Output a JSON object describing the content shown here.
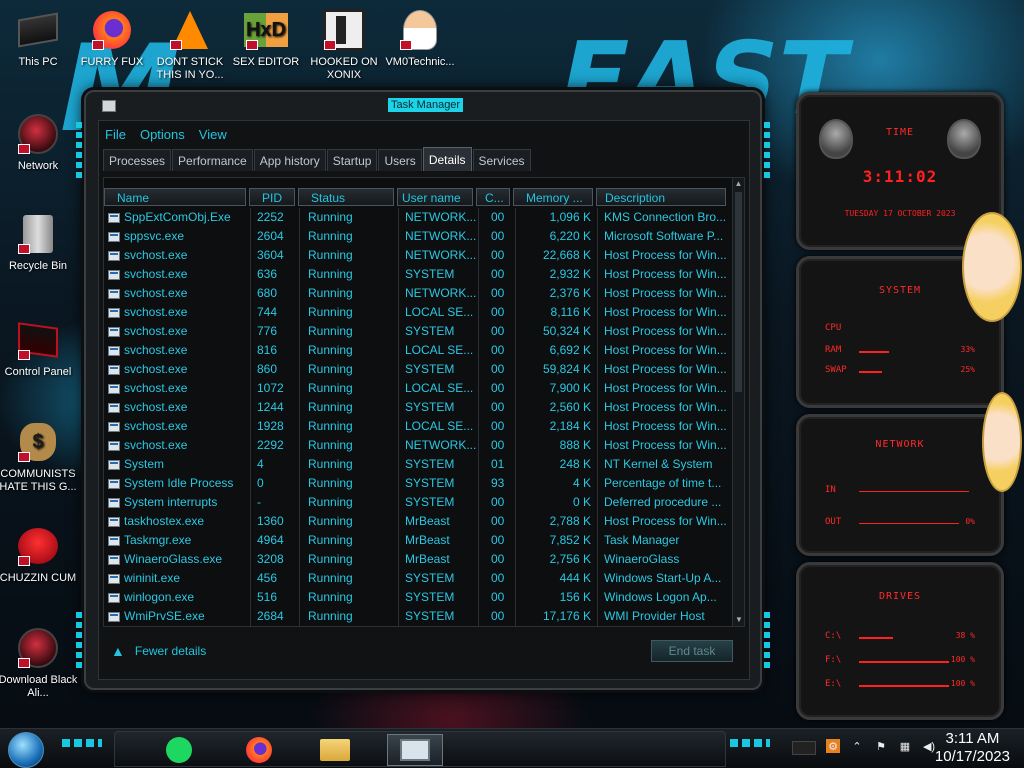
{
  "desktop": {
    "icons": [
      {
        "label": "This PC",
        "icon": "computer-icon"
      },
      {
        "label": "FURRY FUX",
        "icon": "firefox-icon"
      },
      {
        "label": "DONT STICK THIS IN YO...",
        "icon": "vlc-icon"
      },
      {
        "label": "SEX EDITOR",
        "icon": "hxd-icon"
      },
      {
        "label": "HOOKED ON XONIX",
        "icon": "xonix-icon"
      },
      {
        "label": "VM0Technic...",
        "icon": "doctor-icon"
      },
      {
        "label": "Network",
        "icon": "alien-icon"
      },
      {
        "label": "Recycle Bin",
        "icon": "recycle-bin-icon"
      },
      {
        "label": "Control Panel",
        "icon": "control-panel-icon"
      },
      {
        "label": "COMMUNISTS HATE THIS G...",
        "icon": "money-bag-icon"
      },
      {
        "label": "CHUZZIN CUM",
        "icon": "chuzzle-icon"
      },
      {
        "label": "Download Black Ali...",
        "icon": "alien-icon"
      }
    ]
  },
  "taskmgr": {
    "title": "Task Manager",
    "menu": [
      "File",
      "Options",
      "View"
    ],
    "tabs": [
      "Processes",
      "Performance",
      "App history",
      "Startup",
      "Users",
      "Details",
      "Services"
    ],
    "active_tab": "Details",
    "columns": [
      "Name",
      "PID",
      "Status",
      "User name",
      "C...",
      "Memory ...",
      "Description"
    ],
    "rows": [
      [
        "SppExtComObj.Exe",
        "2252",
        "Running",
        "NETWORK...",
        "00",
        "1,096 K",
        "KMS Connection Bro..."
      ],
      [
        "sppsvc.exe",
        "2604",
        "Running",
        "NETWORK...",
        "00",
        "6,220 K",
        "Microsoft Software P..."
      ],
      [
        "svchost.exe",
        "3604",
        "Running",
        "NETWORK...",
        "00",
        "22,668 K",
        "Host Process for Win..."
      ],
      [
        "svchost.exe",
        "636",
        "Running",
        "SYSTEM",
        "00",
        "2,932 K",
        "Host Process for Win..."
      ],
      [
        "svchost.exe",
        "680",
        "Running",
        "NETWORK...",
        "00",
        "2,376 K",
        "Host Process for Win..."
      ],
      [
        "svchost.exe",
        "744",
        "Running",
        "LOCAL SE...",
        "00",
        "8,116 K",
        "Host Process for Win..."
      ],
      [
        "svchost.exe",
        "776",
        "Running",
        "SYSTEM",
        "00",
        "50,324 K",
        "Host Process for Win..."
      ],
      [
        "svchost.exe",
        "816",
        "Running",
        "LOCAL SE...",
        "00",
        "6,692 K",
        "Host Process for Win..."
      ],
      [
        "svchost.exe",
        "860",
        "Running",
        "SYSTEM",
        "00",
        "59,824 K",
        "Host Process for Win..."
      ],
      [
        "svchost.exe",
        "1072",
        "Running",
        "LOCAL SE...",
        "00",
        "7,900 K",
        "Host Process for Win..."
      ],
      [
        "svchost.exe",
        "1244",
        "Running",
        "SYSTEM",
        "00",
        "2,560 K",
        "Host Process for Win..."
      ],
      [
        "svchost.exe",
        "1928",
        "Running",
        "LOCAL SE...",
        "00",
        "2,184 K",
        "Host Process for Win..."
      ],
      [
        "svchost.exe",
        "2292",
        "Running",
        "NETWORK...",
        "00",
        "888 K",
        "Host Process for Win..."
      ],
      [
        "System",
        "4",
        "Running",
        "SYSTEM",
        "01",
        "248 K",
        "NT Kernel & System"
      ],
      [
        "System Idle Process",
        "0",
        "Running",
        "SYSTEM",
        "93",
        "4 K",
        "Percentage of time t..."
      ],
      [
        "System interrupts",
        "-",
        "Running",
        "SYSTEM",
        "00",
        "0 K",
        "Deferred procedure ..."
      ],
      [
        "taskhostex.exe",
        "1360",
        "Running",
        "MrBeast",
        "00",
        "2,788 K",
        "Host Process for Win..."
      ],
      [
        "Taskmgr.exe",
        "4964",
        "Running",
        "MrBeast",
        "00",
        "7,852 K",
        "Task Manager"
      ],
      [
        "WinaeroGlass.exe",
        "3208",
        "Running",
        "MrBeast",
        "00",
        "2,756 K",
        "WinaeroGlass"
      ],
      [
        "wininit.exe",
        "456",
        "Running",
        "SYSTEM",
        "00",
        "444 K",
        "Windows Start-Up A..."
      ],
      [
        "winlogon.exe",
        "516",
        "Running",
        "SYSTEM",
        "00",
        "156 K",
        "Windows Logon Ap..."
      ],
      [
        "WmiPrvSE.exe",
        "2684",
        "Running",
        "SYSTEM",
        "00",
        "17,176 K",
        "WMI Provider Host"
      ]
    ],
    "fewer_details": "Fewer details",
    "end_task": "End task"
  },
  "gadgets": {
    "clock": {
      "title": "TIME",
      "time": "3:11:02",
      "date": "TUESDAY 17 OCTOBER 2023"
    },
    "system": {
      "title": "SYSTEM",
      "cpu_label": "CPU",
      "ram_label": "RAM",
      "ram_val": "33%",
      "swap_label": "SWAP",
      "swap_val": "25%",
      "ram_level": 33,
      "swap_level": 25
    },
    "network": {
      "title": "NETWORK",
      "in_label": "IN",
      "out_label": "OUT",
      "out_val": "0%"
    },
    "drives": {
      "title": "DRIVES",
      "items": [
        {
          "label": "C:\\",
          "val": "38 %",
          "level": 38
        },
        {
          "label": "F:\\",
          "val": "100 %",
          "level": 100
        },
        {
          "label": "E:\\",
          "val": "100 %",
          "level": 100
        }
      ]
    }
  },
  "taskbar": {
    "apps": [
      "spotify-icon",
      "firefox-icon",
      "file-explorer-icon",
      "task-manager-icon"
    ],
    "time": "3:11 AM",
    "date": "10/17/2023"
  },
  "colors": {
    "accent": "#23c5e0",
    "gadget_red": "#ff2020",
    "window_bg": "#101214"
  }
}
